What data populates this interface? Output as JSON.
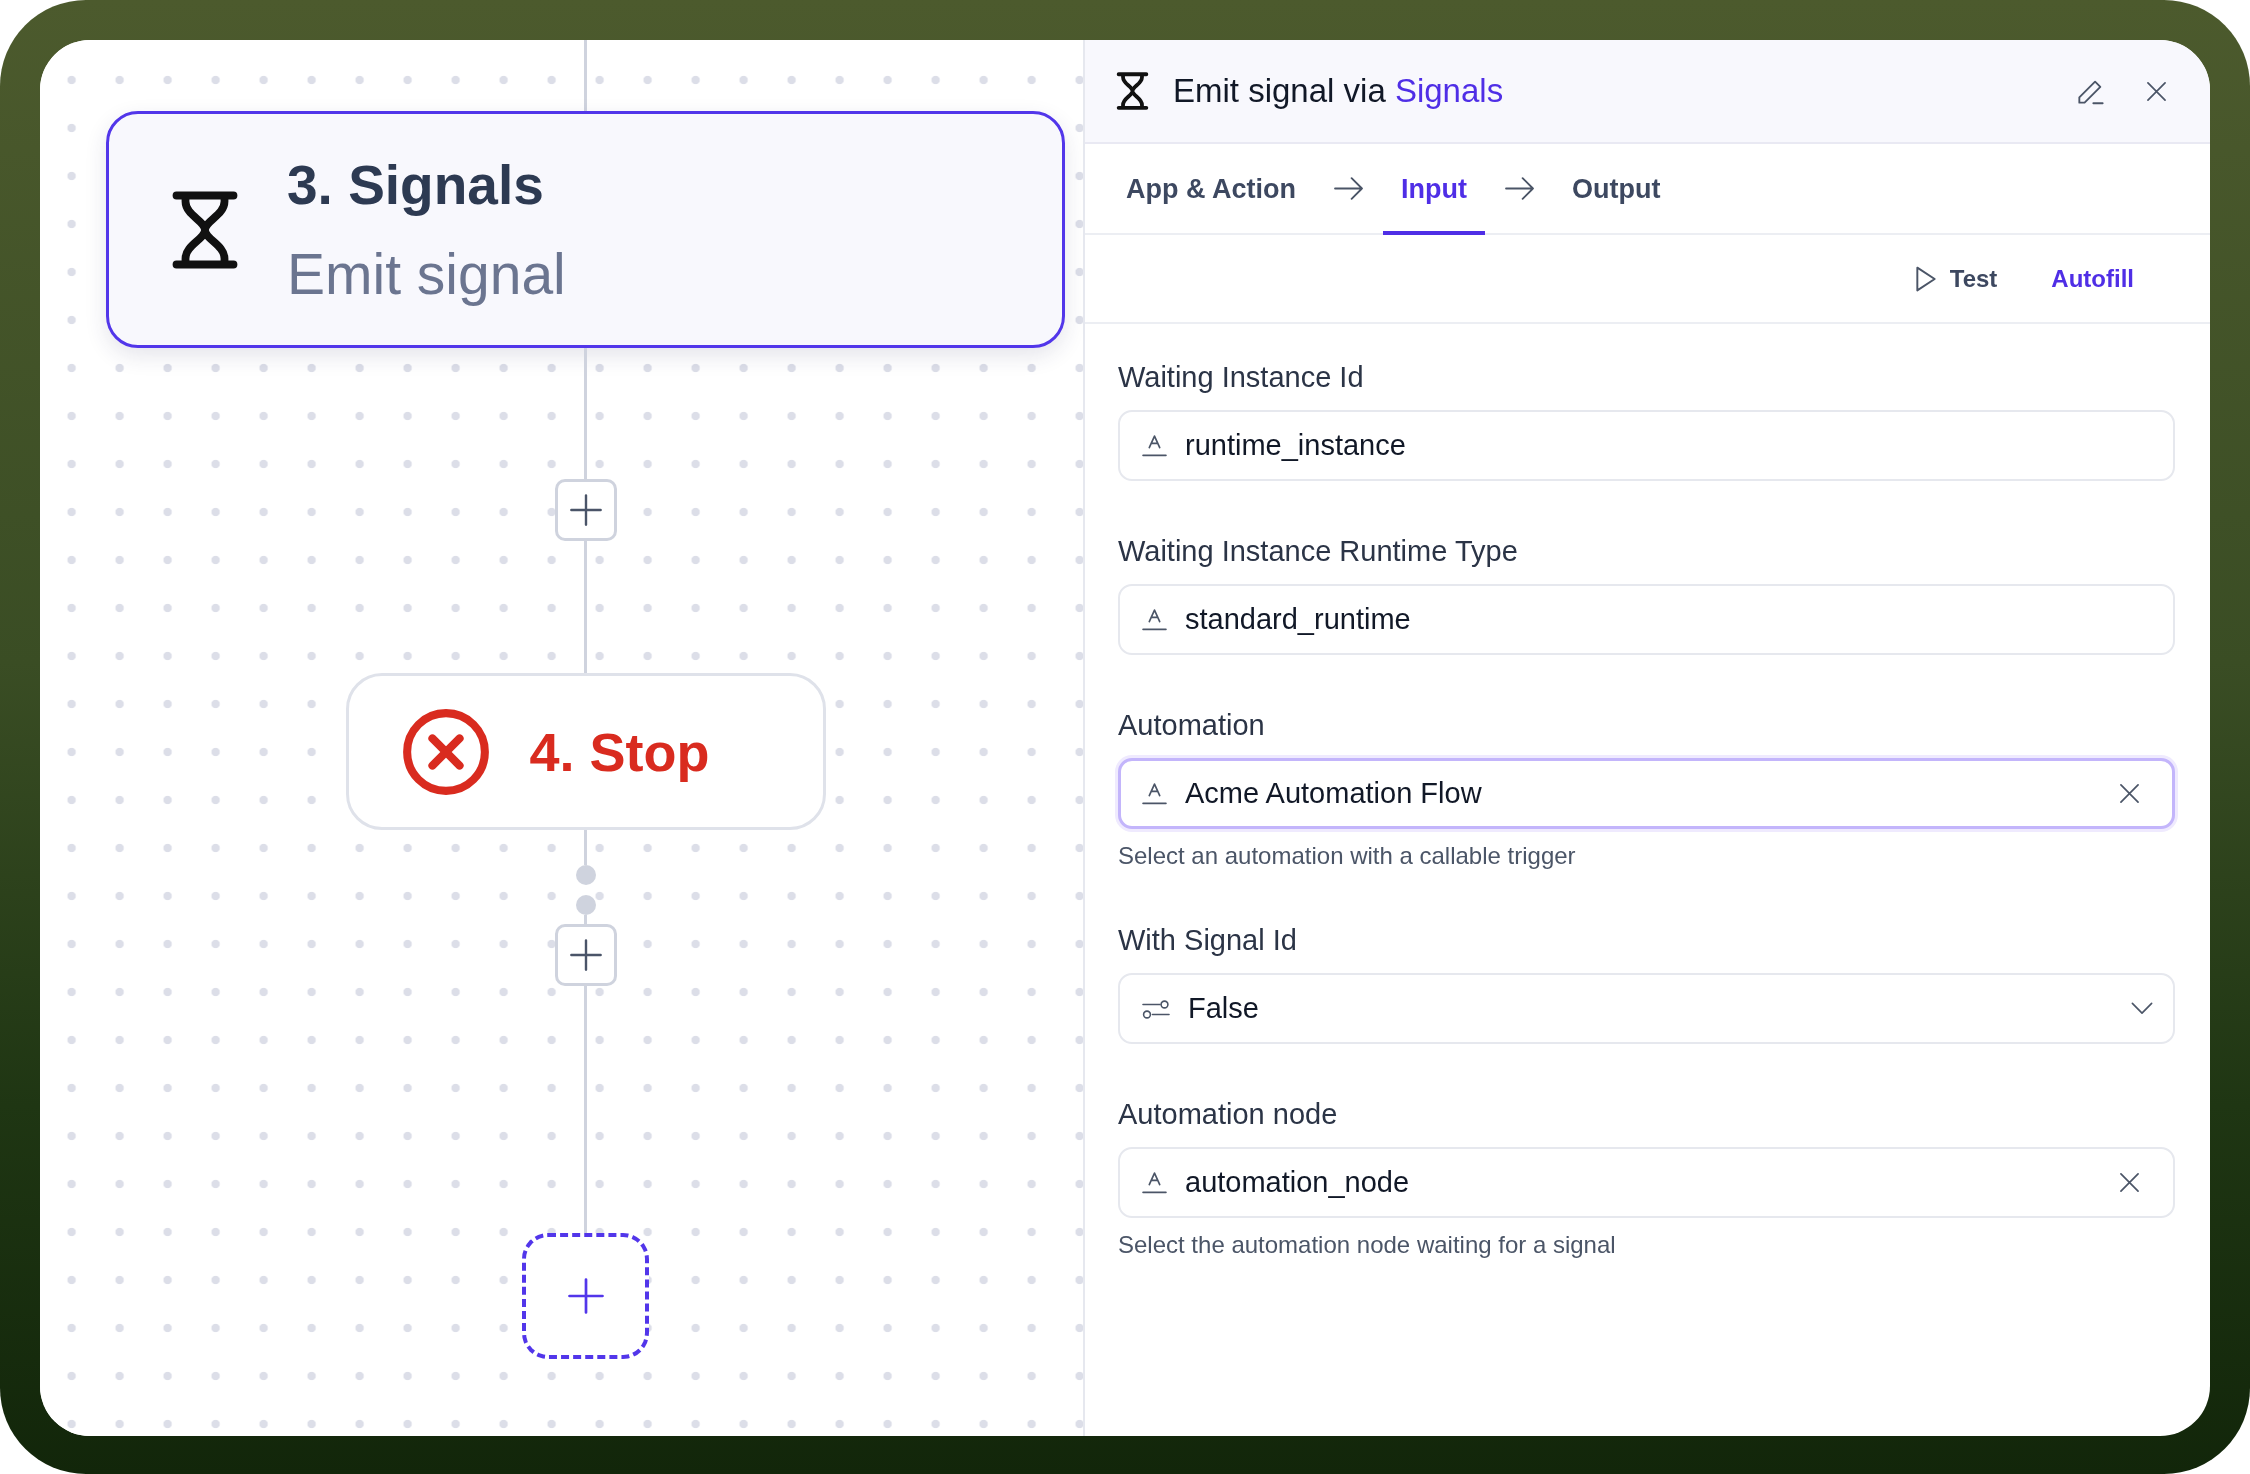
{
  "canvas": {
    "flow": [
      {
        "kind": "action",
        "title": "3. Signals",
        "subtitle": "Emit signal",
        "selected": true
      },
      {
        "kind": "add"
      },
      {
        "kind": "stop",
        "title": "4. Stop",
        "selected": false
      },
      {
        "kind": "junction"
      },
      {
        "kind": "add"
      },
      {
        "kind": "placeholder"
      }
    ]
  },
  "panel": {
    "title": "Emit signal via",
    "app": "Signals",
    "tabs": [
      {
        "label": "App & Action",
        "selected": false
      },
      {
        "label": "Input",
        "selected": true
      },
      {
        "label": "Output",
        "selected": false
      }
    ],
    "actions": [
      {
        "kind": "test",
        "label": "Test"
      },
      {
        "kind": "autofill",
        "label": "Autofill"
      }
    ],
    "fields": [
      {
        "label": "Waiting Instance Id",
        "kind": "text",
        "value": "runtime_instance",
        "clearable": false,
        "focused": false
      },
      {
        "label": "Waiting Instance Runtime Type",
        "kind": "text",
        "value": "standard_runtime",
        "clearable": false,
        "focused": false
      },
      {
        "label": "Automation",
        "kind": "text",
        "value": "Acme Automation Flow",
        "clearable": true,
        "focused": true,
        "hint": "Select an automation with a callable trigger"
      },
      {
        "label": "With Signal Id",
        "kind": "select",
        "value": "False",
        "clearable": false,
        "focused": false
      },
      {
        "label": "Automation node",
        "kind": "text",
        "value": "automation_node",
        "clearable": true,
        "focused": false,
        "hint": "Select the automation node waiting for a signal"
      }
    ]
  }
}
